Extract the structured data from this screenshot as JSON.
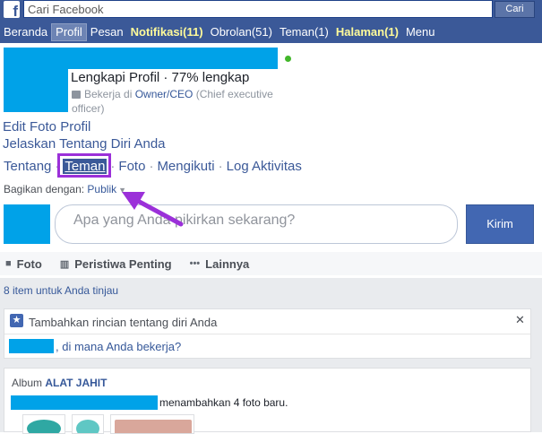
{
  "header": {
    "logo_letter": "f",
    "search": {
      "placeholder": "Cari Facebook",
      "button_label": "Cari"
    },
    "nav": [
      {
        "label": "Beranda"
      },
      {
        "label": "Profil"
      },
      {
        "label": "Pesan"
      },
      {
        "label": "Notifikasi(11)"
      },
      {
        "label": "Obrolan(51)"
      },
      {
        "label": "Teman(1)"
      },
      {
        "label": "Halaman(1)"
      },
      {
        "label": "Menu"
      }
    ]
  },
  "profile": {
    "complete_text": "Lengkapi Profil · 77% lengkap",
    "work_prefix": "Bekerja di ",
    "work_role": "Owner/CEO",
    "work_suffix": " (Chief executive officer)",
    "edit_photo": "Edit Foto Profil",
    "describe_self": "Jelaskan Tentang Diri Anda",
    "tabs": {
      "about": "Tentang",
      "friends": "Teman",
      "photos": "Foto",
      "following": "Mengikuti",
      "activity_log": "Log Aktivitas"
    },
    "separator": "·"
  },
  "composer": {
    "share_label": "Bagikan dengan:",
    "audience": "Publik",
    "placeholder": "Apa yang Anda pikirkan sekarang?",
    "post_button": "Kirim",
    "actions": {
      "photo": "Foto",
      "life_event": "Peristiwa Penting",
      "more": "Lainnya"
    }
  },
  "review": {
    "count_text": "8 item untuk Anda tinjau",
    "card1": {
      "title": "Tambahkan rincian tentang diri Anda",
      "question": ", di mana Anda bekerja?"
    },
    "card2": {
      "album_label": "Album ",
      "album_name": "ALAT JAHIT",
      "added_text": "menambahkan 4 foto baru."
    }
  },
  "colors": {
    "fb_blue": "#3b5998",
    "redaction": "#00a2e8",
    "highlight": "#9b30d9"
  }
}
